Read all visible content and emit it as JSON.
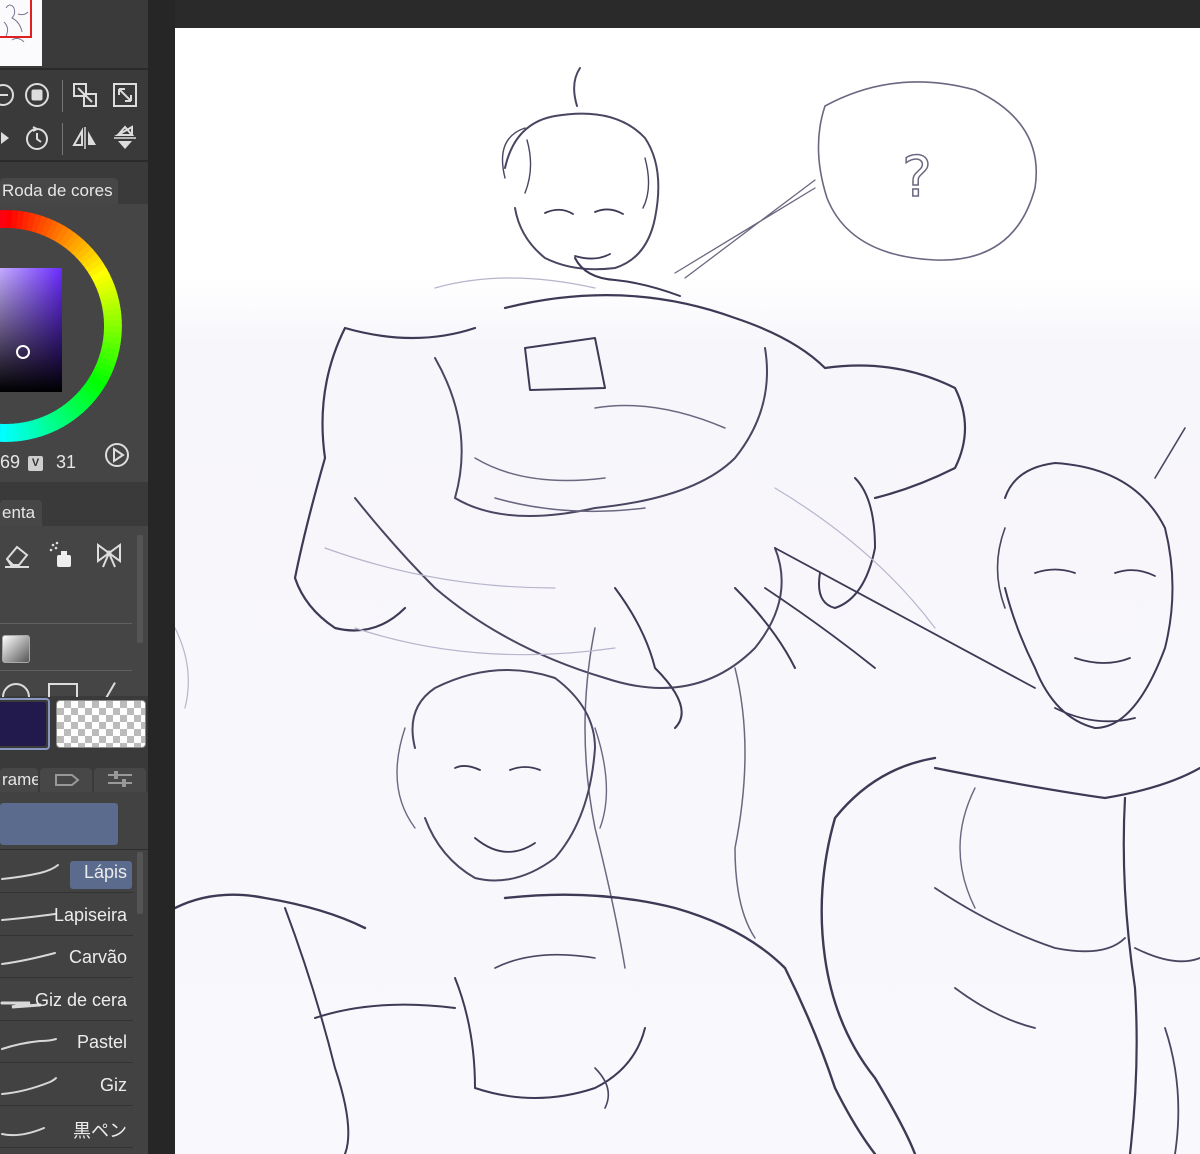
{
  "colors": {
    "main_color": "#221a4c",
    "accent": "#5b6b8d",
    "panel": "#3a3a3a",
    "sketch_stroke": "#3f3a5c"
  },
  "navigator": {
    "thumbnail_icon": "sketch-thumbnail"
  },
  "view_tools": {
    "row1": [
      "zoom-out-icon",
      "stop-icon",
      "fit-window-icon",
      "fullscreen-icon"
    ],
    "row2": [
      "rotate-icon",
      "reset-rotation-icon",
      "flip-horizontal-icon",
      "flip-vertical-icon"
    ]
  },
  "color_wheel": {
    "tab_label": "Roda de cores",
    "h_value": "69",
    "v_label": "V",
    "v_value": "31"
  },
  "tool_panel": {
    "tab_label": "enta",
    "tools": [
      "eraser-icon",
      "airbrush-icon",
      "decoration-icon"
    ],
    "sub_tools": [
      "gradient-icon",
      "ellipse-icon",
      "figure-icon",
      "line-icon"
    ]
  },
  "subtool_panel": {
    "tab_label": "rame",
    "selected_group": "",
    "brushes": [
      {
        "label": "Lápis",
        "selected": true
      },
      {
        "label": "Lapiseira",
        "selected": false
      },
      {
        "label": "Carvão",
        "selected": false
      },
      {
        "label": "Giz de cera",
        "selected": false
      },
      {
        "label": "Pastel",
        "selected": false
      },
      {
        "label": "Giz",
        "selected": false
      },
      {
        "label": "黒ペン",
        "selected": false
      }
    ]
  },
  "canvas": {
    "speech_bubble_text": "?"
  }
}
